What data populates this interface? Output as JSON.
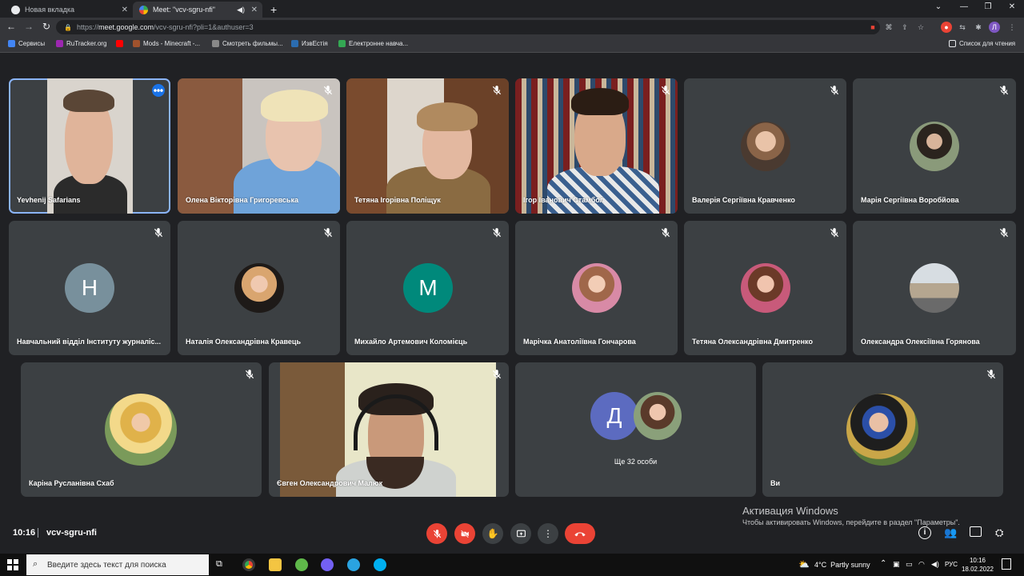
{
  "browser": {
    "tabs": [
      {
        "title": "Новая вкладка",
        "active": false
      },
      {
        "title": "Meet: \"vcv-sgru-nfi\"",
        "active": true
      }
    ],
    "new_tab": "+",
    "url_prefix": "https://",
    "url_host": "meet.google.com",
    "url_rest": "/vcv-sgru-nfi?pli=1&authuser=3",
    "profile_initial": "Л",
    "bookmarks": [
      {
        "label": "Сервисы",
        "color": "#4285f4"
      },
      {
        "label": "RuTracker.org",
        "color": "#9c27b0"
      },
      {
        "label": "",
        "color": "#ff0000"
      },
      {
        "label": "Mods - Minecraft -...",
        "color": "#a0522d"
      },
      {
        "label": "Смотреть фильмы...",
        "color": "#888888"
      },
      {
        "label": "ИзвЕстія",
        "color": "#2b6cb0"
      },
      {
        "label": "Електронне навча...",
        "color": "#34a853"
      }
    ],
    "reading_list": "Список для чтения"
  },
  "meet": {
    "participants": [
      {
        "name": "Yevhenij Safarians",
        "kind": "video",
        "speaking": true
      },
      {
        "name": "Олена Вікторівна Григоревська",
        "kind": "video"
      },
      {
        "name": "Тетяна Ігорівна Поліщук",
        "kind": "video"
      },
      {
        "name": "Ігор Іванович Стамбол",
        "kind": "video"
      },
      {
        "name": "Валерія Сергіївна Кравченко",
        "kind": "photo"
      },
      {
        "name": "Марія Сергіївна Воробйова",
        "kind": "photo"
      },
      {
        "name": "Навчальний відділ Інституту журналіс...",
        "kind": "letter",
        "letter": "Н",
        "color": "#78909c"
      },
      {
        "name": "Наталія Олександрівна Кравець",
        "kind": "photo"
      },
      {
        "name": "Михайло Артемович Коломієць",
        "kind": "letter",
        "letter": "М",
        "color": "#00897b"
      },
      {
        "name": "Марічка Анатоліївна Гончарова",
        "kind": "photo"
      },
      {
        "name": "Тетяна Олександрівна Дмитренко",
        "kind": "photo"
      },
      {
        "name": "Олександра Олексіївна Горянова",
        "kind": "photo"
      },
      {
        "name": "Каріна Русланівна Схаб",
        "kind": "photo"
      },
      {
        "name": "Євген Олександрович Малюк",
        "kind": "video"
      },
      {
        "name": "Ще 32 особи",
        "kind": "more",
        "letter": "Д",
        "color": "#5c6bc0"
      },
      {
        "name": "Ви",
        "kind": "photo"
      }
    ],
    "meeting_time": "10:16",
    "meeting_code": "vcv-sgru-nfi"
  },
  "activation": {
    "title": "Активация Windows",
    "subtitle": "Чтобы активировать Windows, перейдите в раздел \"Параметры\"."
  },
  "taskbar": {
    "search_placeholder": "Введите здесь текст для поиска",
    "weather": "4°C  Partly sunny",
    "language": "РУС",
    "time": "10:16",
    "date": "18.02.2022"
  },
  "colors": {
    "background": "#202124",
    "tile": "#3c4043",
    "speaking_outline": "#8ab4f8",
    "danger": "#ea4335"
  }
}
